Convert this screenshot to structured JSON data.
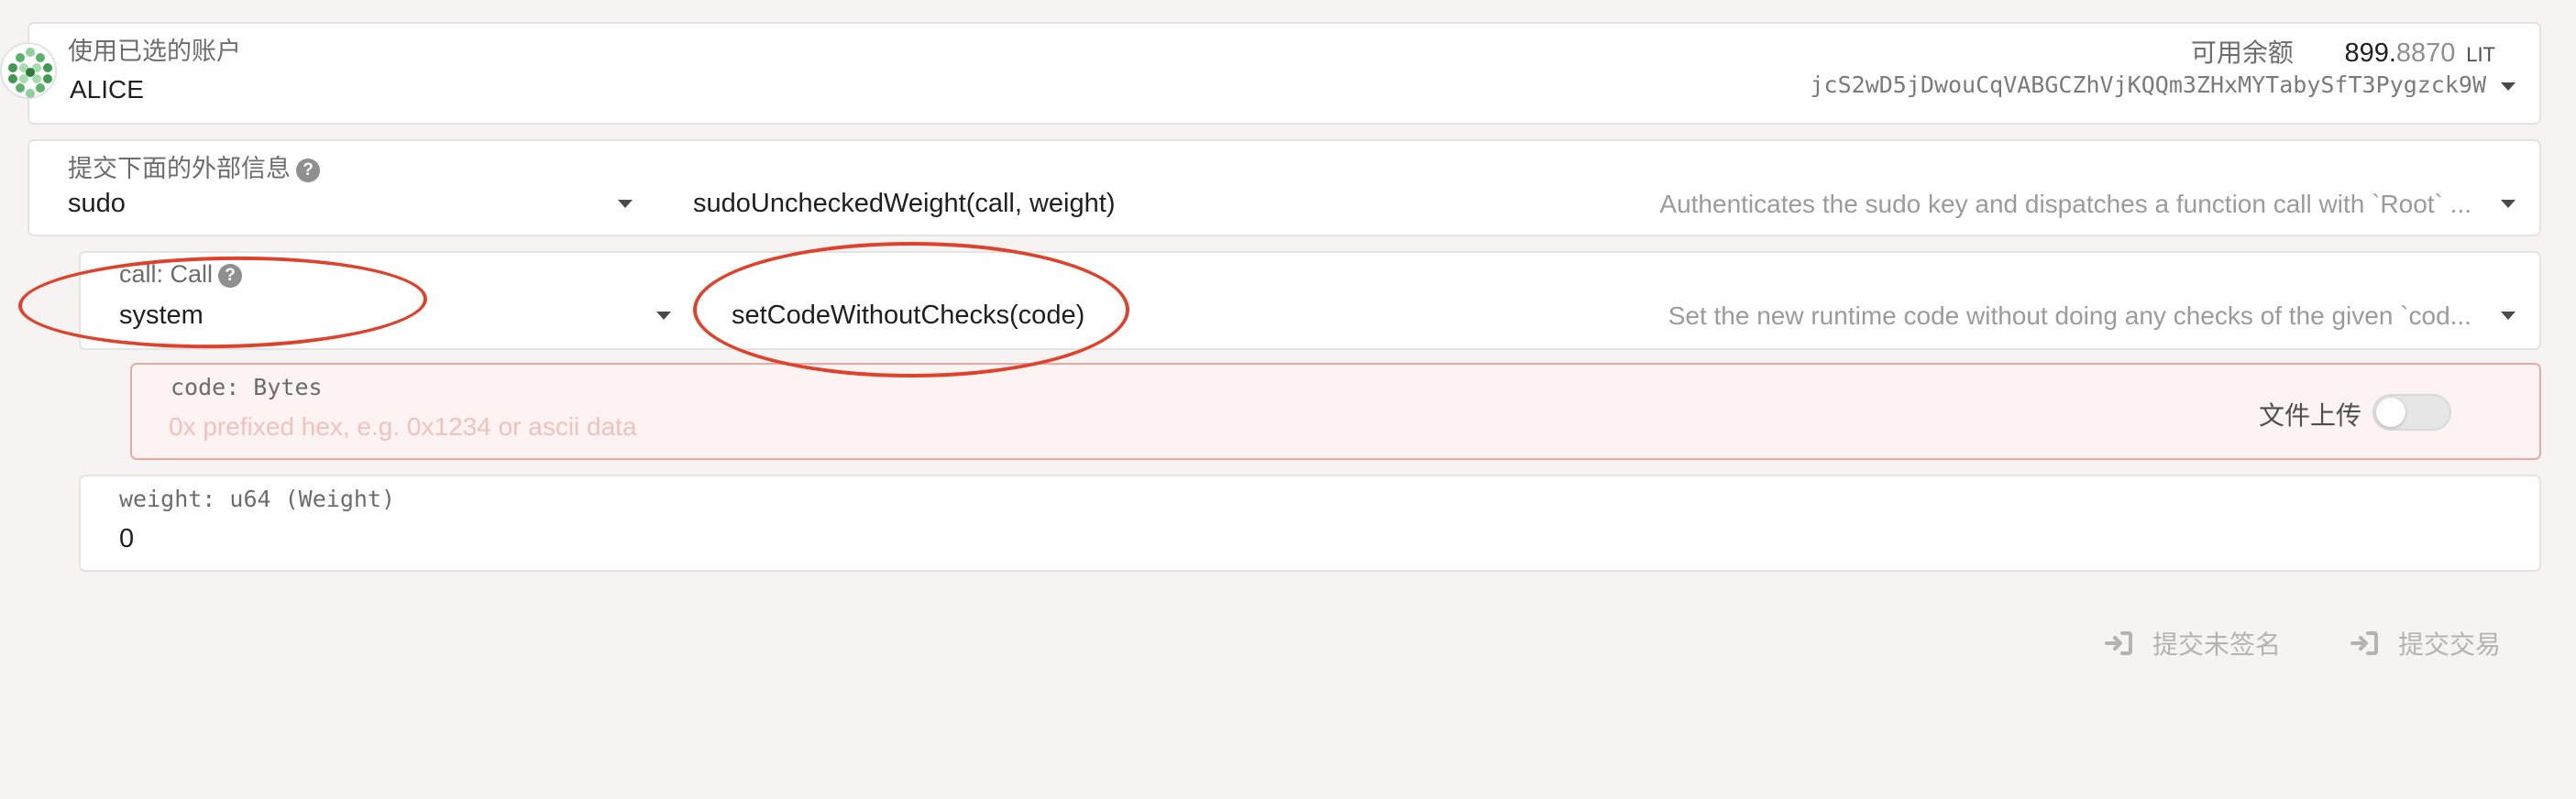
{
  "account": {
    "label": "使用已选的账户",
    "name": "ALICE",
    "balance_label": "可用余额",
    "balance_int": "899.",
    "balance_dec": "8870",
    "balance_unit": "LIT",
    "address": "jcS2wD5jDwouCqVABGCZhVjKQQm3ZHxMYTabySfT3Pygzck9W"
  },
  "extrinsic": {
    "label": "提交下面的外部信息",
    "pallet": "sudo",
    "method": "sudoUncheckedWeight(call, weight)",
    "description": "Authenticates the sudo key and dispatches a function call with `Root` ..."
  },
  "call": {
    "label": "call: Call",
    "pallet": "system",
    "method": "setCodeWithoutChecks(code)",
    "description": "Set the new runtime code without doing any checks of the given `cod..."
  },
  "code": {
    "label": "code: Bytes",
    "placeholder": "0x prefixed hex, e.g. 0x1234 or ascii data",
    "file_upload_label": "文件上传"
  },
  "weight": {
    "label": "weight: u64 (Weight)",
    "value": "0"
  },
  "actions": {
    "submit_unsigned": "提交未签名",
    "submit_signed": "提交交易"
  },
  "colors": {
    "annotation": "#e0412a",
    "error_bg": "#fdf3f2",
    "error_border": "#e9a9a3"
  }
}
